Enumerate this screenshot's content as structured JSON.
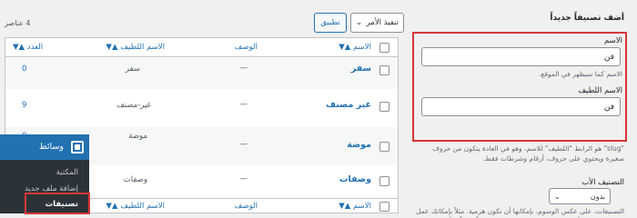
{
  "form": {
    "title": "أضف تصنيفاً جديداً",
    "name_label": "الاسم",
    "name_value": "فن",
    "name_hint": "الاسم كما سيظهر في الموقع.",
    "slug_label": "الاسم اللطيف",
    "slug_value": "فن",
    "slug_desc": "\"slug\" هو الرابط \"اللطيف\" للاسم، وهو في العادة يتكون من حروف صغيرة ويحتوي على حروف، أرقام وشرطات فقط.",
    "parent_label": "التصنيف الأب",
    "parent_value": "بدون",
    "parent_desc": "التصنيفات، على عكس الوسوم، بإمكانها أن تكون هرمية. مثلاً بإمكانك عمل تصنيف خاص بالأخبار، وتحت هذا التصنيف تضع تصنيفاً خاصاً بالأخبار المحلية."
  },
  "toolbar": {
    "bulk_action": "تنفيذ الأمر",
    "apply": "تطبيق",
    "items_count": "4 عناصر"
  },
  "table": {
    "columns": {
      "name": "الاسم",
      "description": "الوصف",
      "slug": "الاسم اللطيف",
      "count": "العدد"
    },
    "rows": [
      {
        "name": "سفر",
        "description": "—",
        "slug": "سفر",
        "count": "0"
      },
      {
        "name": "غير مصنف",
        "description": "—",
        "slug": "غير-مصنف",
        "count": "9"
      },
      {
        "name": "موضة",
        "description": "—",
        "slug": "موضة",
        "count": "0"
      },
      {
        "name": "وصفات",
        "description": "—",
        "slug": "وصفات",
        "count": "0"
      }
    ]
  },
  "menu": {
    "title": "وسائط",
    "items": [
      "المكتبة",
      "إضافة ملف جديد",
      "تصنيفات"
    ]
  },
  "colors": {
    "accent": "#2271b1",
    "highlight_border": "#d63638",
    "admin_bar": "#2c3338"
  }
}
